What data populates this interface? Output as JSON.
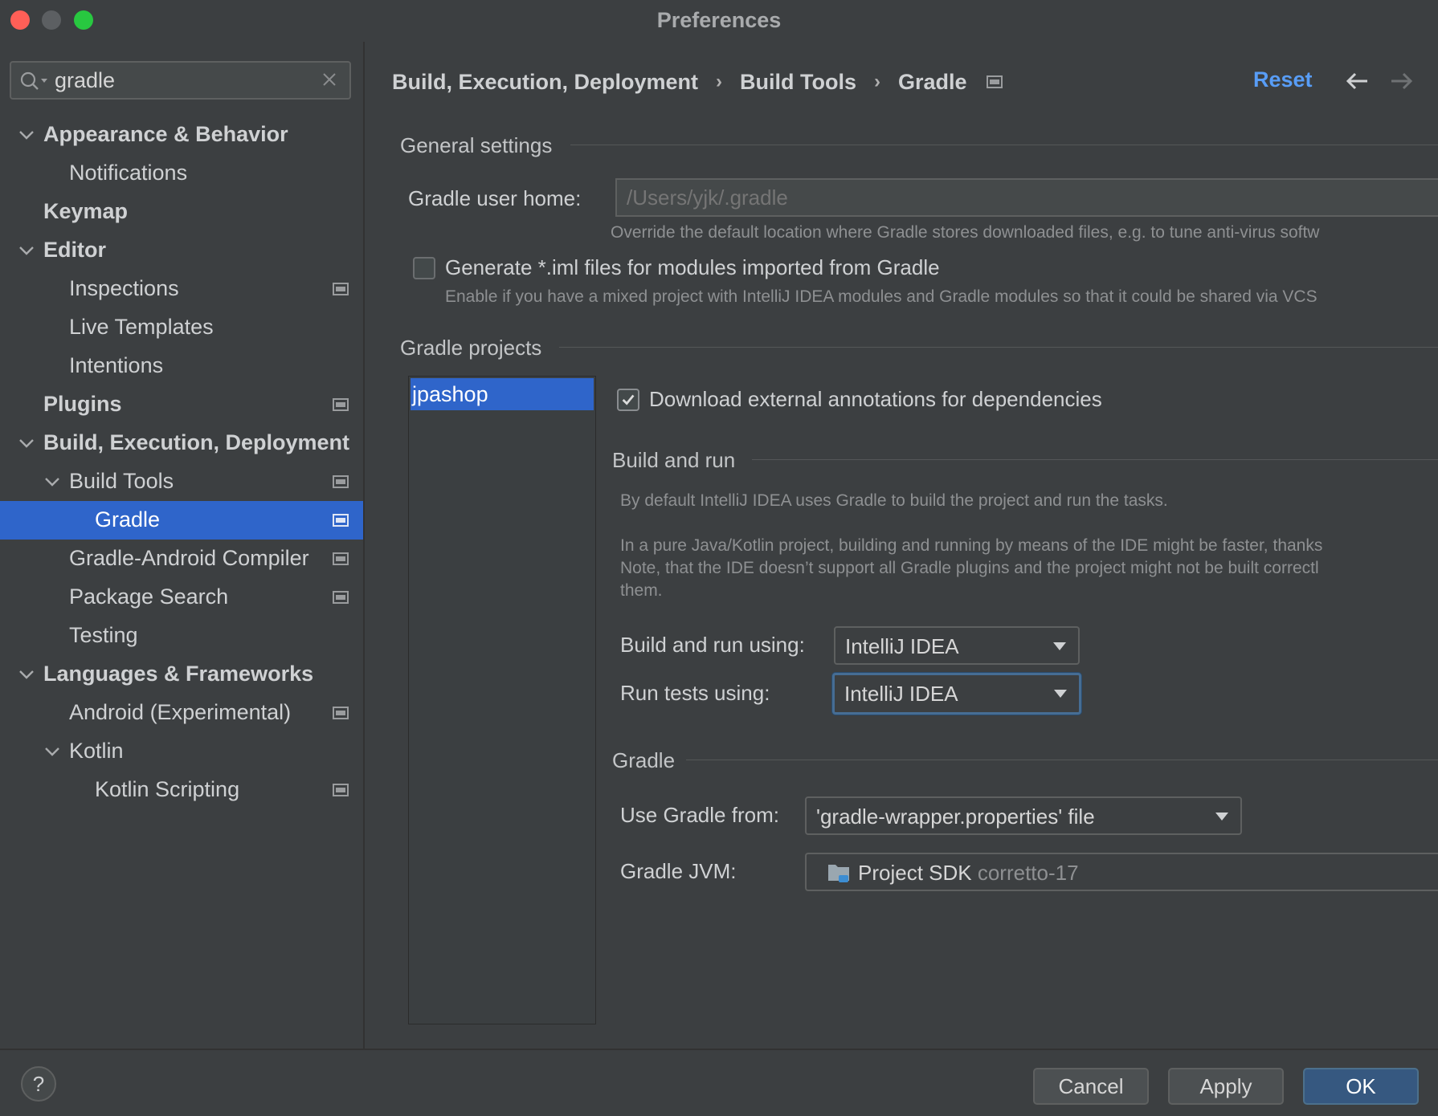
{
  "window": {
    "title": "Preferences"
  },
  "search": {
    "value": "gradle"
  },
  "sidebar": {
    "items": [
      {
        "label": "Appearance & Behavior",
        "level": 0,
        "bold": true,
        "expanded": true,
        "badge": false
      },
      {
        "label": "Notifications",
        "level": 1,
        "bold": false,
        "badge": false
      },
      {
        "label": "Keymap",
        "level": 0,
        "bold": true,
        "badge": false
      },
      {
        "label": "Editor",
        "level": 0,
        "bold": true,
        "expanded": true,
        "badge": false
      },
      {
        "label": "Inspections",
        "level": 1,
        "bold": false,
        "badge": true
      },
      {
        "label": "Live Templates",
        "level": 1,
        "bold": false,
        "badge": false
      },
      {
        "label": "Intentions",
        "level": 1,
        "bold": false,
        "badge": false
      },
      {
        "label": "Plugins",
        "level": 0,
        "bold": true,
        "badge": true
      },
      {
        "label": "Build, Execution, Deployment",
        "level": 0,
        "bold": true,
        "expanded": true,
        "badge": false
      },
      {
        "label": "Build Tools",
        "level": 1,
        "bold": false,
        "expanded": true,
        "badge": true
      },
      {
        "label": "Gradle",
        "level": 2,
        "bold": false,
        "badge": true,
        "selected": true
      },
      {
        "label": "Gradle-Android Compiler",
        "level": 1,
        "bold": false,
        "badge": true
      },
      {
        "label": "Package Search",
        "level": 1,
        "bold": false,
        "badge": true
      },
      {
        "label": "Testing",
        "level": 1,
        "bold": false,
        "badge": false
      },
      {
        "label": "Languages & Frameworks",
        "level": 0,
        "bold": true,
        "expanded": true,
        "badge": false
      },
      {
        "label": "Android (Experimental)",
        "level": 1,
        "bold": false,
        "badge": true
      },
      {
        "label": "Kotlin",
        "level": 1,
        "bold": false,
        "expanded": true,
        "badge": false
      },
      {
        "label": "Kotlin Scripting",
        "level": 2,
        "bold": false,
        "badge": true
      }
    ]
  },
  "breadcrumb": {
    "items": [
      "Build, Execution, Deployment",
      "Build Tools",
      "Gradle"
    ],
    "separator": "›"
  },
  "header": {
    "reset_label": "Reset"
  },
  "general": {
    "title": "General settings",
    "user_home_label": "Gradle user home:",
    "user_home_placeholder": "/Users/yjk/.gradle",
    "user_home_hint": "Override the default location where Gradle stores downloaded files, e.g. to tune anti-virus softw",
    "iml_label": "Generate *.iml files for modules imported from Gradle",
    "iml_checked": false,
    "iml_hint": "Enable if you have a mixed project with IntelliJ IDEA modules and Gradle modules so that it could be shared via VCS"
  },
  "projects": {
    "title": "Gradle projects",
    "list": [
      "jpashop"
    ],
    "annotations_label": "Download external annotations for dependencies",
    "annotations_checked": true
  },
  "build_run": {
    "title": "Build and run",
    "desc1": "By default IntelliJ IDEA uses Gradle to build the project and run the tasks.",
    "desc2_line1": "In a pure Java/Kotlin project, building and running by means of the IDE might be faster, thanks",
    "desc2_line2": "Note, that the IDE doesn’t support all Gradle plugins and the project might not be built correctl",
    "desc2_line3": "them.",
    "build_using_label": "Build and run using:",
    "build_using_value": "IntelliJ IDEA",
    "tests_using_label": "Run tests using:",
    "tests_using_value": "IntelliJ IDEA"
  },
  "gradle": {
    "title": "Gradle",
    "use_from_label": "Use Gradle from:",
    "use_from_value": "'gradle-wrapper.properties' file",
    "jvm_label": "Gradle JVM:",
    "jvm_value": "Project SDK",
    "jvm_version": "corretto-17"
  },
  "footer": {
    "help_label": "?",
    "cancel_label": "Cancel",
    "apply_label": "Apply",
    "ok_label": "OK"
  },
  "colors": {
    "accent": "#2f65ca",
    "link": "#589df6",
    "background": "#3c3f41"
  }
}
